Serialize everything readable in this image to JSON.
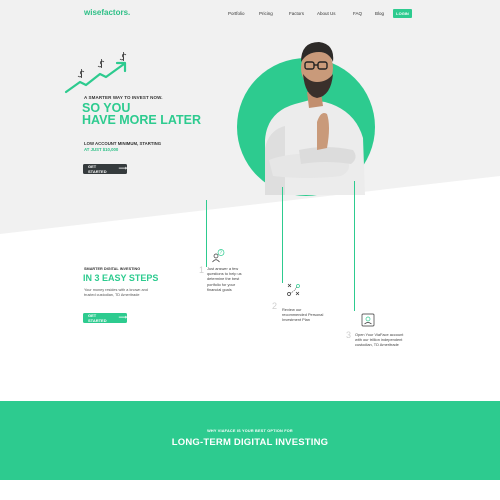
{
  "brand": {
    "logo": "wisefactors.",
    "accent": "#2dcb8f",
    "dark_button": "#353b3d"
  },
  "nav": {
    "items": [
      "Portfolio",
      "Pricing",
      "Factors",
      "About Us",
      "FAQ",
      "Blog"
    ],
    "login": "LOGIN"
  },
  "hero": {
    "tagline": "A SMARTER WAY TO INVEST NOW.",
    "headline_line1": "SO YOU",
    "headline_line2": "HAVE MORE LATER",
    "min_label": "LOW ACCOUNT MINIMUM, STARTING",
    "min_value": "AT JUST $10,000",
    "cta": "GET STARTED",
    "cta_icon": "arrow-right-icon"
  },
  "steps": {
    "label": "SMARTER DIGITAL INVESTING",
    "title": "IN 3 EASY STEPS",
    "desc_line1": "Your money resides with a known and",
    "desc_line2": "trusted custodian, TD Ameritrade",
    "cta": "GET STARTED",
    "items": [
      {
        "num": "1",
        "icon": "person-question-icon",
        "lines": [
          "Just answer a few",
          "questions to help us",
          "determine the best",
          "portfolio for your",
          "financial goals"
        ]
      },
      {
        "num": "2",
        "icon": "strategy-icon",
        "lines": [
          "Review our",
          "recommended Personal",
          "Investment Plan"
        ]
      },
      {
        "num": "3",
        "icon": "account-card-icon",
        "lines": [
          "Open Your ViaFace account",
          "with our trillion independent",
          "custodian, TD Ameritrade"
        ]
      }
    ]
  },
  "band": {
    "subtitle": "WHY VIAFACE IS YOUR BEST OPTION FOR",
    "title": "LONG-TERM DIGITAL INVESTING"
  }
}
